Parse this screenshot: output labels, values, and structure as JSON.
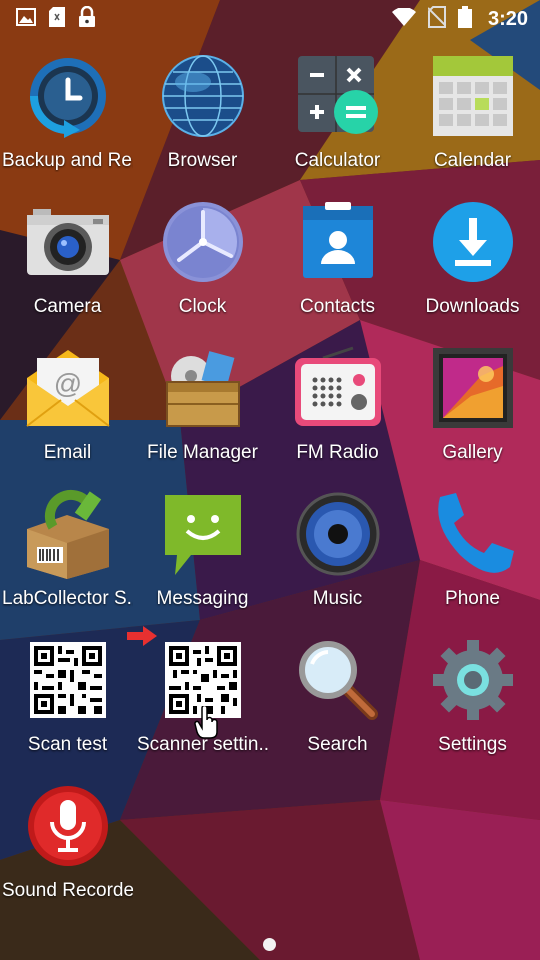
{
  "status_bar": {
    "time": "3:20",
    "left_icons": [
      "image-icon",
      "sim-card-icon",
      "lock-icon"
    ],
    "right_icons": [
      "wifi-icon",
      "no-sim-icon",
      "battery-icon"
    ]
  },
  "apps": [
    {
      "label": "Backup and Re..",
      "icon": "backup-icon"
    },
    {
      "label": "Browser",
      "icon": "browser-globe-icon"
    },
    {
      "label": "Calculator",
      "icon": "calculator-icon"
    },
    {
      "label": "Calendar",
      "icon": "calendar-icon"
    },
    {
      "label": "Camera",
      "icon": "camera-icon"
    },
    {
      "label": "Clock",
      "icon": "clock-icon"
    },
    {
      "label": "Contacts",
      "icon": "contacts-icon"
    },
    {
      "label": "Downloads",
      "icon": "download-icon"
    },
    {
      "label": "Email",
      "icon": "email-icon"
    },
    {
      "label": "File Manager",
      "icon": "file-manager-icon"
    },
    {
      "label": "FM Radio",
      "icon": "radio-icon"
    },
    {
      "label": "Gallery",
      "icon": "gallery-icon"
    },
    {
      "label": "LabCollector S..",
      "icon": "labcollector-icon"
    },
    {
      "label": "Messaging",
      "icon": "messaging-icon"
    },
    {
      "label": "Music",
      "icon": "music-icon"
    },
    {
      "label": "Phone",
      "icon": "phone-icon"
    },
    {
      "label": "Scan test",
      "icon": "qr-code-icon"
    },
    {
      "label": "Scanner settin..",
      "icon": "qr-code-icon"
    },
    {
      "label": "Search",
      "icon": "search-icon"
    },
    {
      "label": "Settings",
      "icon": "gear-icon"
    },
    {
      "label": "Sound Recorder",
      "icon": "microphone-icon"
    }
  ],
  "pager": {
    "current_page": 1
  }
}
